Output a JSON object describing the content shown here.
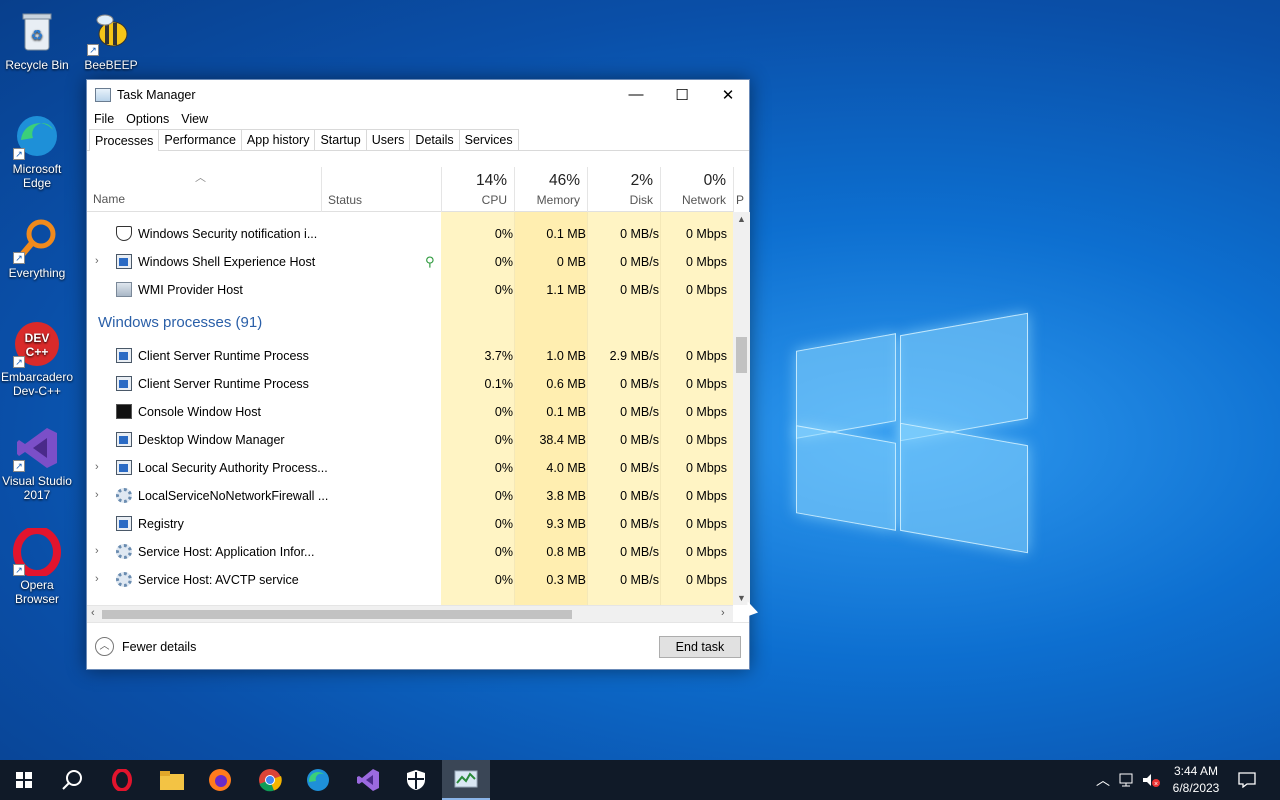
{
  "desktop": {
    "icons": [
      {
        "label": "Recycle Bin"
      },
      {
        "label": "BeeBEEP"
      },
      {
        "label": "Microsoft Edge"
      },
      {
        "label": "Everything"
      },
      {
        "label": "Embarcadero Dev-C++"
      },
      {
        "label": "Visual Studio 2017"
      },
      {
        "label": "Opera Browser"
      }
    ]
  },
  "window": {
    "title": "Task Manager",
    "controls": {
      "minimize": "—",
      "maximize": "☐",
      "close": "✕"
    },
    "menu": [
      "File",
      "Options",
      "View"
    ],
    "tabs": [
      "Processes",
      "Performance",
      "App history",
      "Startup",
      "Users",
      "Details",
      "Services"
    ],
    "active_tab": "Processes",
    "columns": {
      "name": "Name",
      "status": "Status",
      "cpu": {
        "pct": "14%",
        "label": "CPU"
      },
      "memory": {
        "pct": "46%",
        "label": "Memory"
      },
      "disk": {
        "pct": "2%",
        "label": "Disk"
      },
      "network": {
        "pct": "0%",
        "label": "Network"
      },
      "power": "P"
    },
    "rows": [
      {
        "name": "Windows Security notification i...",
        "cpu": "0%",
        "mem": "0.1 MB",
        "disk": "0 MB/s",
        "net": "0 Mbps"
      },
      {
        "name": "Windows Shell Experience Host",
        "cpu": "0%",
        "mem": "0 MB",
        "disk": "0 MB/s",
        "net": "0 Mbps"
      },
      {
        "name": "WMI Provider Host",
        "cpu": "0%",
        "mem": "1.1 MB",
        "disk": "0 MB/s",
        "net": "0 Mbps"
      }
    ],
    "group_label": "Windows processes (91)",
    "win_rows": [
      {
        "name": "Client Server Runtime Process",
        "cpu": "3.7%",
        "mem": "1.0 MB",
        "disk": "2.9 MB/s",
        "net": "0 Mbps"
      },
      {
        "name": "Client Server Runtime Process",
        "cpu": "0.1%",
        "mem": "0.6 MB",
        "disk": "0 MB/s",
        "net": "0 Mbps"
      },
      {
        "name": "Console Window Host",
        "cpu": "0%",
        "mem": "0.1 MB",
        "disk": "0 MB/s",
        "net": "0 Mbps"
      },
      {
        "name": "Desktop Window Manager",
        "cpu": "0%",
        "mem": "38.4 MB",
        "disk": "0 MB/s",
        "net": "0 Mbps"
      },
      {
        "name": "Local Security Authority Process...",
        "cpu": "0%",
        "mem": "4.0 MB",
        "disk": "0 MB/s",
        "net": "0 Mbps"
      },
      {
        "name": "LocalServiceNoNetworkFirewall ...",
        "cpu": "0%",
        "mem": "3.8 MB",
        "disk": "0 MB/s",
        "net": "0 Mbps"
      },
      {
        "name": "Registry",
        "cpu": "0%",
        "mem": "9.3 MB",
        "disk": "0 MB/s",
        "net": "0 Mbps"
      },
      {
        "name": "Service Host: Application Infor...",
        "cpu": "0%",
        "mem": "0.8 MB",
        "disk": "0 MB/s",
        "net": "0 Mbps"
      },
      {
        "name": "Service Host: AVCTP service",
        "cpu": "0%",
        "mem": "0.3 MB",
        "disk": "0 MB/s",
        "net": "0 Mbps"
      }
    ],
    "fewer_details": "Fewer details",
    "end_task": "End task"
  },
  "taskbar": {
    "clock_time": "3:44 AM",
    "clock_date": "6/8/2023"
  },
  "colors": {
    "heat_light": "#fff4c4",
    "heat_mid": "#ffeeb0",
    "heat_strong": "#f9e49a",
    "group_text": "#2a5fa8",
    "taskbar": "#101a28"
  }
}
